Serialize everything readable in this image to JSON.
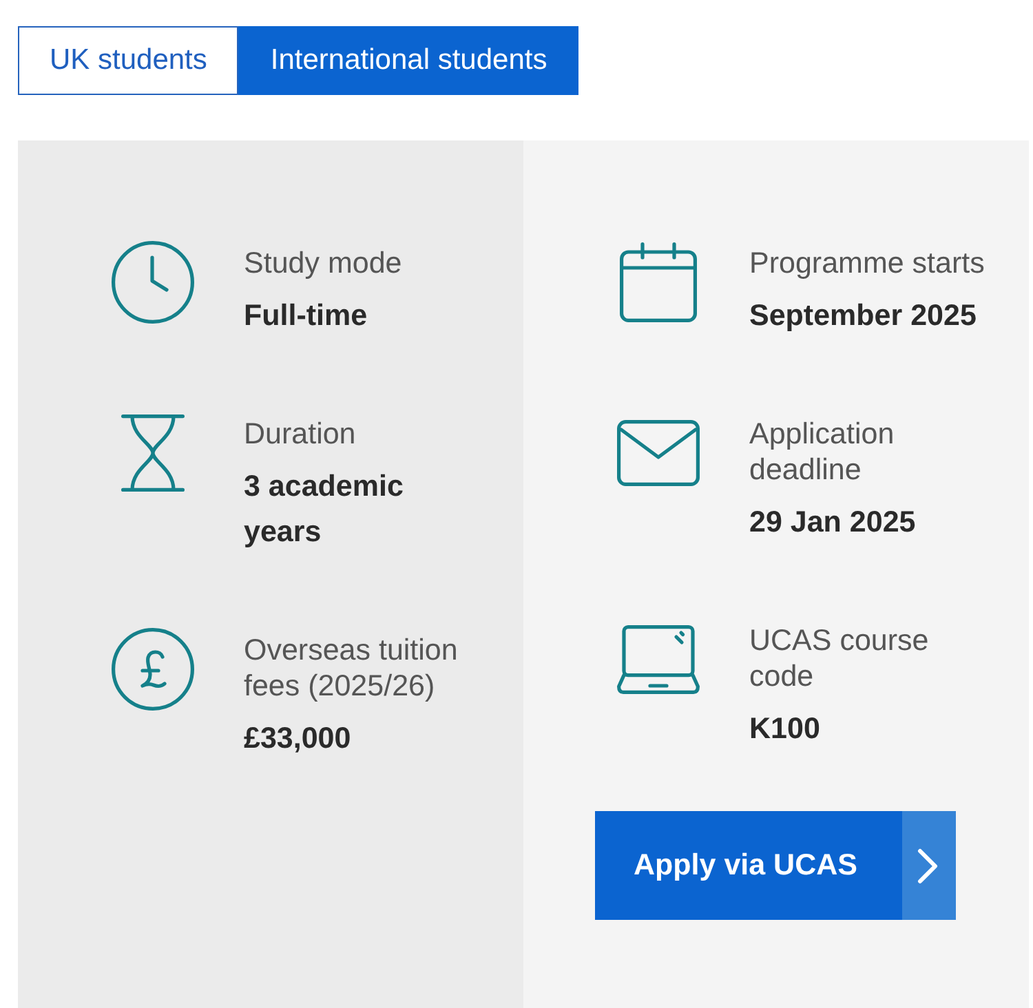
{
  "tabs": [
    {
      "label": "UK students",
      "selected": false
    },
    {
      "label": "International students",
      "selected": true
    }
  ],
  "columns": [
    {
      "items": [
        {
          "kind": "clock",
          "label": "Study mode",
          "value": "Full-time"
        },
        {
          "kind": "hourglass",
          "label": "Duration",
          "value": "3 academic years"
        },
        {
          "kind": "pound",
          "label": "Overseas tuition fees (2025/26)",
          "value": "£33,000"
        }
      ]
    },
    {
      "items": [
        {
          "kind": "calendar",
          "label": "Programme starts",
          "value": "September 2025"
        },
        {
          "kind": "envelope",
          "label": "Application deadline",
          "value": "29 Jan 2025"
        },
        {
          "kind": "laptop",
          "label": "UCAS course code",
          "value": "K100"
        }
      ]
    }
  ],
  "apply_button": {
    "label": "Apply via UCAS"
  }
}
